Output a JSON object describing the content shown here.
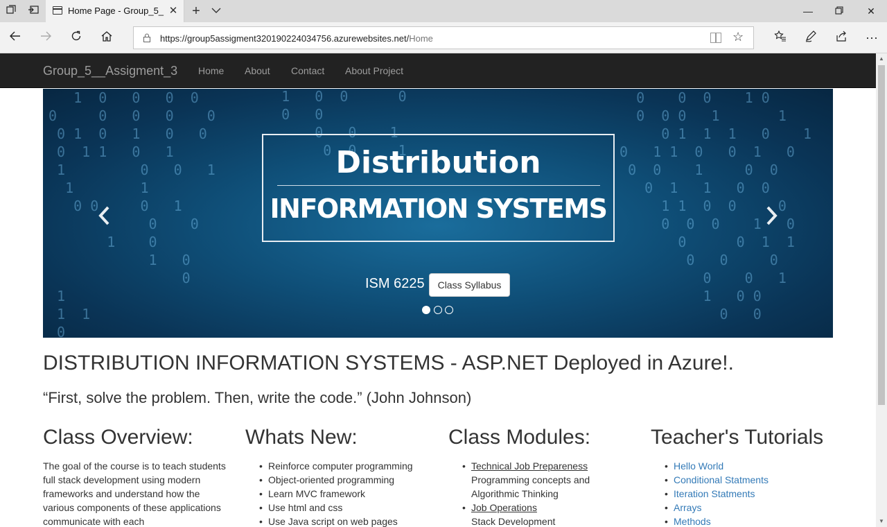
{
  "browser": {
    "tab_title": "Home Page - Group_5_",
    "url_main": "https://group5assigment320190224034756.azurewebsites.net/",
    "url_path": "Home"
  },
  "site": {
    "brand": "Group_5__Assigment_3",
    "nav": [
      "Home",
      "About",
      "Contact",
      "About Project"
    ]
  },
  "carousel": {
    "banner_title": "Distribution",
    "banner_subtitle": "INFORMATION SYSTEMS",
    "caption": "ISM 6225",
    "button": "Class Syllabus",
    "slides": 3,
    "active_slide": 1
  },
  "main": {
    "heading": "DISTRIBUTION INFORMATION SYSTEMS - ASP.NET Deployed in Azure!.",
    "quote": "“First, solve the problem. Then, write the code.” (John Johnson)"
  },
  "columns": {
    "overview": {
      "title": "Class Overview:",
      "text": "The goal of the course is to teach students full stack development using modern frameworks and understand how the various components of these applications communicate with each"
    },
    "whats_new": {
      "title": "Whats New:",
      "items": [
        "Reinforce computer programming",
        "Object-oriented programming",
        "Learn MVC framework",
        "Use html and css",
        "Use Java script on web pages"
      ]
    },
    "modules": {
      "title": "Class Modules:",
      "m1": "Technical Job Prepareness",
      "m1_desc1": "Programming concepts and",
      "m1_desc2": "Algorithmic Thinking",
      "m2": "Job Operations",
      "m2_desc1": "Stack Development"
    },
    "tutorials": {
      "title": "Teacher's Tutorials",
      "items": [
        "Hello World",
        "Conditional Statments",
        "Iteration Statments",
        "Arrays",
        "Methods"
      ]
    }
  },
  "colors": {
    "navbar_bg": "#222222",
    "link": "#337ab7",
    "carousel_blue": "#0f4f78"
  }
}
